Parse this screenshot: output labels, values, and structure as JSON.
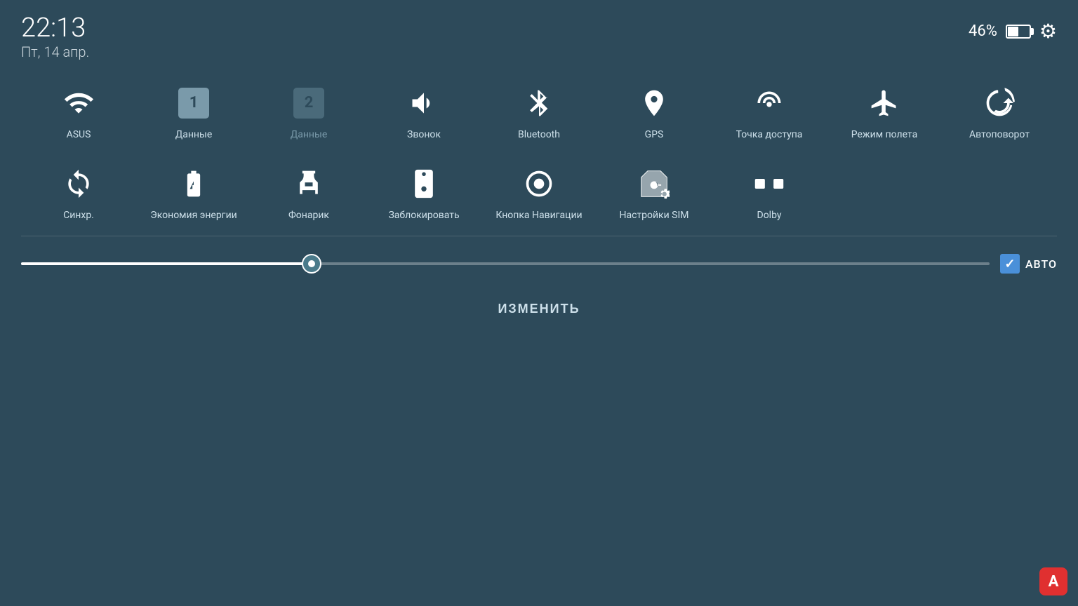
{
  "header": {
    "time": "22:13",
    "date": "Пт, 14 апр.",
    "battery_percent": "46%",
    "settings_label": "⚙"
  },
  "quick_settings_row1": [
    {
      "id": "wifi",
      "label": "ASUS",
      "active": true
    },
    {
      "id": "data1",
      "label": "Данные",
      "active": true
    },
    {
      "id": "data2",
      "label": "Данные",
      "active": false
    },
    {
      "id": "sound",
      "label": "Звонок",
      "active": true
    },
    {
      "id": "bluetooth",
      "label": "Bluetooth",
      "active": true
    },
    {
      "id": "gps",
      "label": "GPS",
      "active": true
    },
    {
      "id": "hotspot",
      "label": "Точка доступа",
      "active": true
    },
    {
      "id": "airplane",
      "label": "Режим полета",
      "active": true
    },
    {
      "id": "autorotate",
      "label": "Автоповорот",
      "active": true
    }
  ],
  "quick_settings_row2": [
    {
      "id": "sync",
      "label": "Синхр.",
      "active": true
    },
    {
      "id": "battery_save",
      "label": "Экономия энергии",
      "active": true
    },
    {
      "id": "flashlight",
      "label": "Фонарик",
      "active": true
    },
    {
      "id": "lock",
      "label": "Заблокировать",
      "active": true
    },
    {
      "id": "nav_button",
      "label": "Кнопка Навигации",
      "active": true
    },
    {
      "id": "sim_settings",
      "label": "Настройки SIM",
      "active": true
    },
    {
      "id": "dolby",
      "label": "Dolby",
      "active": true
    }
  ],
  "brightness": {
    "auto_label": "АВТО",
    "value": 30
  },
  "edit_button_label": "ИЗМЕНИТЬ",
  "asus_app_letter": "A"
}
